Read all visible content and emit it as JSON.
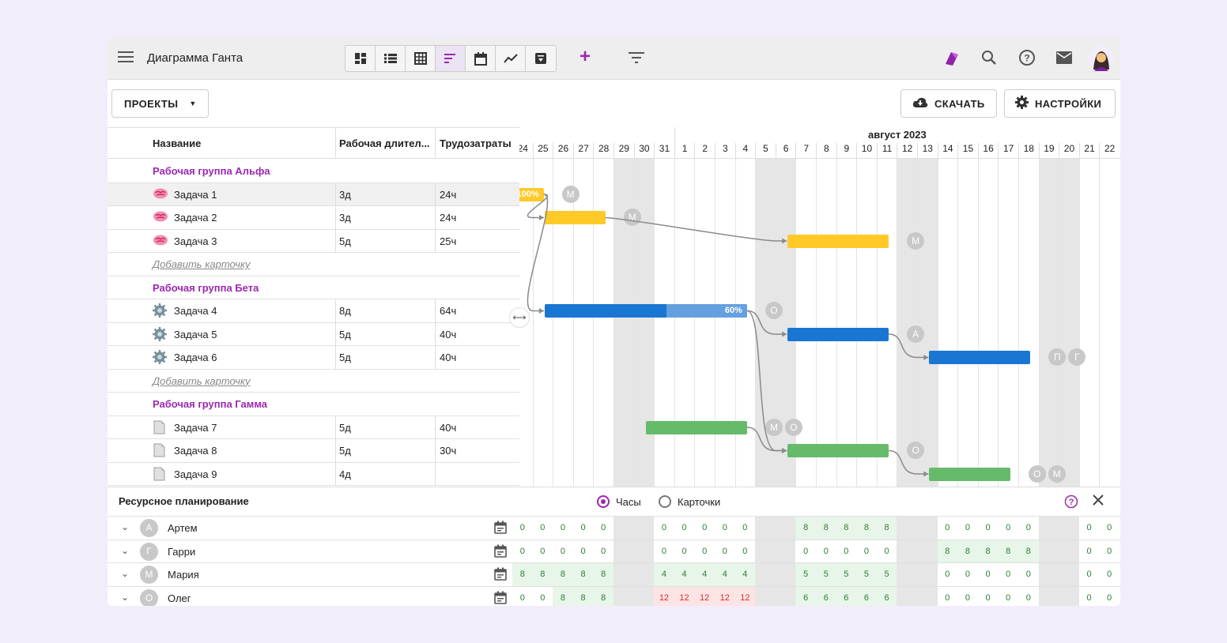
{
  "app": {
    "title": "Диаграмма Ганта"
  },
  "toolbar": {
    "projects_label": "ПРОЕКТЫ",
    "download_label": "СКАЧАТЬ",
    "settings_label": "НАСТРОЙКИ"
  },
  "table": {
    "headers": {
      "name": "Название",
      "duration": "Рабочая длител...",
      "effort": "Трудозатраты"
    },
    "groups": [
      {
        "name": "Рабочая группа Альфа",
        "icon": "brain-icon",
        "tasks": [
          {
            "name": "Задача 1",
            "duration": "3д",
            "effort": "24ч"
          },
          {
            "name": "Задача 2",
            "duration": "3д",
            "effort": "24ч"
          },
          {
            "name": "Задача 3",
            "duration": "5д",
            "effort": "25ч"
          }
        ]
      },
      {
        "name": "Рабочая группа Бета",
        "icon": "gear-icon",
        "tasks": [
          {
            "name": "Задача 4",
            "duration": "8д",
            "effort": "64ч"
          },
          {
            "name": "Задача 5",
            "duration": "5д",
            "effort": "40ч"
          },
          {
            "name": "Задача 6",
            "duration": "5д",
            "effort": "40ч"
          }
        ]
      },
      {
        "name": "Рабочая группа Гамма",
        "icon": "document-icon",
        "tasks": [
          {
            "name": "Задача 7",
            "duration": "5д",
            "effort": "40ч"
          },
          {
            "name": "Задача 8",
            "duration": "5д",
            "effort": "30ч"
          },
          {
            "name": "Задача 9",
            "duration": "4д",
            "effort": ""
          }
        ]
      }
    ],
    "add_card_label": "Добавить карточку"
  },
  "gantt": {
    "month_label": "август 2023",
    "days": [
      "24",
      "25",
      "26",
      "27",
      "28",
      "29",
      "30",
      "31",
      "1",
      "2",
      "3",
      "4",
      "5",
      "6",
      "7",
      "8",
      "9",
      "10",
      "11",
      "12",
      "13",
      "14",
      "15",
      "16",
      "17",
      "18",
      "19",
      "20",
      "21",
      "22"
    ],
    "progress_labels": {
      "task1": "100%",
      "task4": "60%"
    },
    "badges": {
      "task1": [
        "М"
      ],
      "task2": [
        "М"
      ],
      "task3": [
        "М"
      ],
      "task4": [
        "О"
      ],
      "task5": [
        "А"
      ],
      "task6": [
        "П",
        "Г"
      ],
      "task7": [
        "М",
        "О"
      ],
      "task8": [
        "О"
      ],
      "task9": [
        "О",
        "М"
      ]
    },
    "colors": {
      "alpha": "#ffca28",
      "beta": "#1976d2",
      "beta_light": "#64a0e0",
      "gamma": "#66bb6a",
      "accent": "#9c27b0"
    }
  },
  "resources": {
    "title": "Ресурсное планирование",
    "mode_hours": "Часы",
    "mode_cards": "Карточки",
    "people": [
      {
        "initial": "А",
        "name": "Артем",
        "hours": [
          "0",
          "0",
          "0",
          "0",
          "0",
          "",
          "",
          "0",
          "0",
          "0",
          "0",
          "0",
          "",
          "",
          "8",
          "8",
          "8",
          "8",
          "8",
          "",
          "",
          "0",
          "0",
          "0",
          "0",
          "0",
          "",
          "",
          "0",
          "0"
        ]
      },
      {
        "initial": "Г",
        "name": "Гарри",
        "hours": [
          "0",
          "0",
          "0",
          "0",
          "0",
          "",
          "",
          "0",
          "0",
          "0",
          "0",
          "0",
          "",
          "",
          "0",
          "0",
          "0",
          "0",
          "0",
          "",
          "",
          "8",
          "8",
          "8",
          "8",
          "8",
          "",
          "",
          "0",
          "0"
        ]
      },
      {
        "initial": "М",
        "name": "Мария",
        "hours": [
          "8",
          "8",
          "8",
          "8",
          "8",
          "",
          "",
          "4",
          "4",
          "4",
          "4",
          "4",
          "",
          "",
          "5",
          "5",
          "5",
          "5",
          "5",
          "",
          "",
          "0",
          "0",
          "0",
          "0",
          "0",
          "",
          "",
          "0",
          "0"
        ]
      },
      {
        "initial": "О",
        "name": "Олег",
        "hours": [
          "0",
          "0",
          "8",
          "8",
          "8",
          "",
          "",
          "12",
          "12",
          "12",
          "12",
          "12",
          "",
          "",
          "6",
          "6",
          "6",
          "6",
          "6",
          "",
          "",
          "0",
          "0",
          "0",
          "0",
          "0",
          "",
          "",
          "0",
          "0"
        ]
      }
    ]
  }
}
